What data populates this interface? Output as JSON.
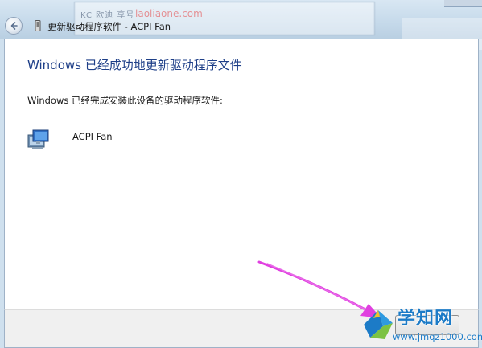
{
  "window": {
    "title": "更新驱动程序软件 - ACPI Fan"
  },
  "background": {
    "ghost_text": "KC 欧迪 享号",
    "ghost_watermark": "laoliaone.com"
  },
  "content": {
    "heading": "Windows 已经成功地更新驱动程序文件",
    "description": "Windows 已经完成安装此设备的驱动程序软件:",
    "device": {
      "name": "ACPI Fan",
      "icon": "monitor-device-icon"
    }
  },
  "watermark": {
    "title": "学知网",
    "url": "www.jmqz1000.com",
    "logo_icon": "windows-logo-icon"
  },
  "colors": {
    "heading": "#1e3f88",
    "annotation_arrow": "#e040e0",
    "watermark": "#1c7bc7"
  }
}
